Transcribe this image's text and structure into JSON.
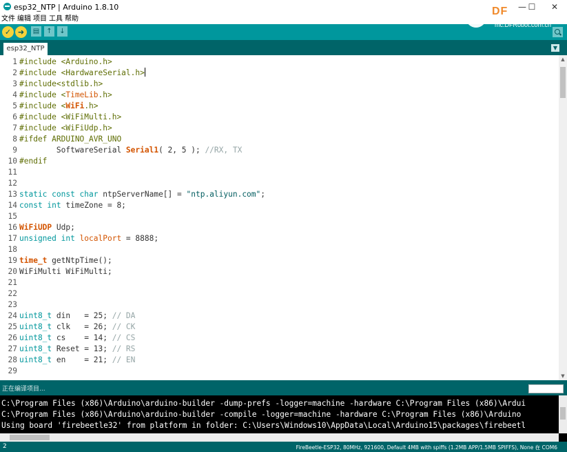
{
  "window": {
    "title": "esp32_NTP | Arduino 1.8.10",
    "minimize": "—",
    "maximize": "☐",
    "close": "✕"
  },
  "menu": [
    "文件",
    "编辑",
    "项目",
    "工具",
    "帮助"
  ],
  "toolbar": {
    "verify": "✓",
    "upload": "➜",
    "new": "▤",
    "open": "↑",
    "save": "↓"
  },
  "logo": {
    "text": "DF",
    "url": "mc.DFRobot.com.cn"
  },
  "tab": {
    "name": "esp32_NTP",
    "menu": "▼"
  },
  "editor": {
    "lines": [
      {
        "n": "1",
        "parts": [
          {
            "t": "#include <Arduino.h>",
            "c": "pp"
          }
        ]
      },
      {
        "n": "2",
        "parts": [
          {
            "t": "#include <HardwareSerial.h>",
            "c": "pp"
          }
        ],
        "cursor": true
      },
      {
        "n": "3",
        "parts": [
          {
            "t": "#include<stdlib.h>",
            "c": "pp"
          }
        ]
      },
      {
        "n": "4",
        "parts": [
          {
            "t": "#include <",
            "c": "pp"
          },
          {
            "t": "TimeLib",
            "c": "lib"
          },
          {
            "t": ".h>",
            "c": "pp"
          }
        ]
      },
      {
        "n": "5",
        "parts": [
          {
            "t": "#include <",
            "c": "pp"
          },
          {
            "t": "WiFi",
            "c": "bold"
          },
          {
            "t": ".h>",
            "c": "pp"
          }
        ]
      },
      {
        "n": "6",
        "parts": [
          {
            "t": "#include <WiFiMulti.h>",
            "c": "pp"
          }
        ]
      },
      {
        "n": "7",
        "parts": [
          {
            "t": "#include <WiFiUdp.h>",
            "c": "pp"
          }
        ]
      },
      {
        "n": "8",
        "parts": [
          {
            "t": "#ifdef ARDUINO_AVR_UNO",
            "c": "pp"
          }
        ]
      },
      {
        "n": "9",
        "parts": [
          {
            "t": "        SoftwareSerial ",
            "c": ""
          },
          {
            "t": "Serial1",
            "c": "bold"
          },
          {
            "t": "( 2, 5 ); ",
            "c": ""
          },
          {
            "t": "//RX, TX",
            "c": "com"
          }
        ]
      },
      {
        "n": "10",
        "parts": [
          {
            "t": "#endif",
            "c": "pp"
          }
        ]
      },
      {
        "n": "11",
        "parts": []
      },
      {
        "n": "12",
        "parts": []
      },
      {
        "n": "13",
        "parts": [
          {
            "t": "static const char ",
            "c": "kw"
          },
          {
            "t": "ntpServerName[] = ",
            "c": ""
          },
          {
            "t": "\"ntp.aliyun.com\"",
            "c": "str"
          },
          {
            "t": ";",
            "c": ""
          }
        ]
      },
      {
        "n": "14",
        "parts": [
          {
            "t": "const int ",
            "c": "kw"
          },
          {
            "t": "timeZone = 8;",
            "c": ""
          }
        ]
      },
      {
        "n": "15",
        "parts": []
      },
      {
        "n": "16",
        "parts": [
          {
            "t": "WiFiUDP",
            "c": "bold"
          },
          {
            "t": " Udp;",
            "c": ""
          }
        ]
      },
      {
        "n": "17",
        "parts": [
          {
            "t": "unsigned int ",
            "c": "kw"
          },
          {
            "t": "localPort",
            "c": "lib"
          },
          {
            "t": " = 8888;",
            "c": ""
          }
        ]
      },
      {
        "n": "18",
        "parts": []
      },
      {
        "n": "19",
        "parts": [
          {
            "t": "time_t",
            "c": "bold"
          },
          {
            "t": " getNtpTime();",
            "c": ""
          }
        ]
      },
      {
        "n": "20",
        "parts": [
          {
            "t": "WiFiMulti WiFiMulti;",
            "c": ""
          }
        ]
      },
      {
        "n": "21",
        "parts": []
      },
      {
        "n": "22",
        "parts": []
      },
      {
        "n": "23",
        "parts": []
      },
      {
        "n": "24",
        "parts": [
          {
            "t": "uint8_t",
            "c": "kw"
          },
          {
            "t": " din   = 25; ",
            "c": ""
          },
          {
            "t": "// DA",
            "c": "com"
          }
        ]
      },
      {
        "n": "25",
        "parts": [
          {
            "t": "uint8_t",
            "c": "kw"
          },
          {
            "t": " clk   = 26; ",
            "c": ""
          },
          {
            "t": "// CK",
            "c": "com"
          }
        ]
      },
      {
        "n": "26",
        "parts": [
          {
            "t": "uint8_t",
            "c": "kw"
          },
          {
            "t": " cs    = 14; ",
            "c": ""
          },
          {
            "t": "// CS",
            "c": "com"
          }
        ]
      },
      {
        "n": "27",
        "parts": [
          {
            "t": "uint8_t",
            "c": "kw"
          },
          {
            "t": " Reset = 13; ",
            "c": ""
          },
          {
            "t": "// RS",
            "c": "com"
          }
        ]
      },
      {
        "n": "28",
        "parts": [
          {
            "t": "uint8_t",
            "c": "kw"
          },
          {
            "t": " en    = 21; ",
            "c": ""
          },
          {
            "t": "// EN",
            "c": "com"
          }
        ]
      },
      {
        "n": "29",
        "parts": []
      }
    ]
  },
  "status": {
    "message": "正在编译项目..."
  },
  "console": {
    "lines": [
      "C:\\Program Files (x86)\\Arduino\\arduino-builder -dump-prefs -logger=machine -hardware C:\\Program Files (x86)\\Ardui",
      "C:\\Program Files (x86)\\Arduino\\arduino-builder -compile -logger=machine -hardware C:\\Program Files (x86)\\Arduino",
      "Using board 'firebeetle32' from platform in folder: C:\\Users\\Windows10\\AppData\\Local\\Arduino15\\packages\\firebeetl"
    ]
  },
  "footer": {
    "line_number": "2",
    "board_info": "FireBeetle-ESP32, 80MHz, 921600, Default 4MB with spiffs (1.2MB APP/1.5MB SPIFFS), None 在 COM6"
  },
  "colors": {
    "toolbar": "#00979d",
    "tabbar": "#006468",
    "keyword": "#00979c",
    "library": "#d35400",
    "comment": "#95a5a6",
    "string": "#005c5f"
  }
}
